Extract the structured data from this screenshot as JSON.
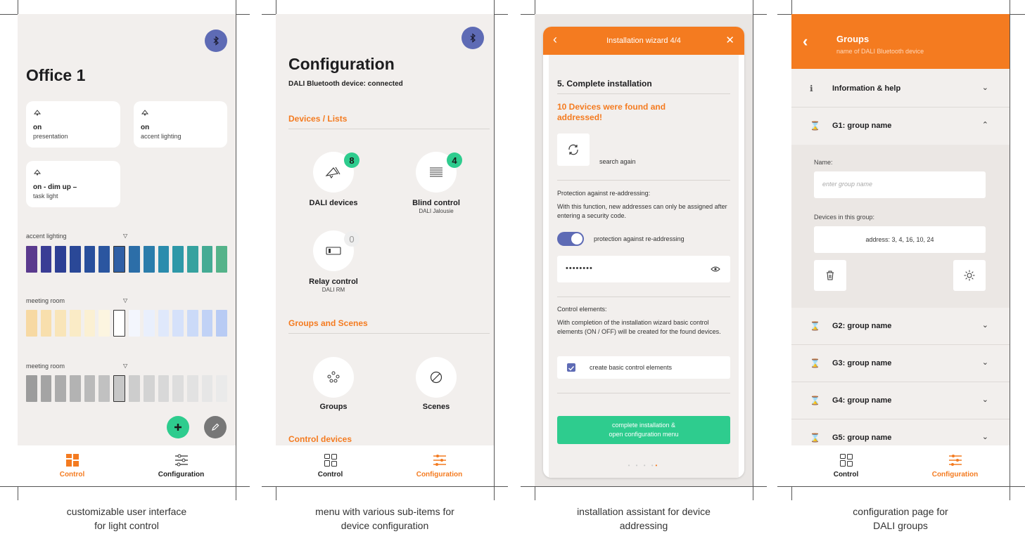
{
  "captions": {
    "p1": [
      "customizable user interface",
      "for light control"
    ],
    "p2": [
      "menu with various sub-items for",
      "device configuration"
    ],
    "p3": [
      "installation assistant for device",
      "addressing"
    ],
    "p4": [
      "configuration page for",
      "DALI groups"
    ]
  },
  "colors": {
    "accent": "#f47b20",
    "green": "#2ecc8e",
    "bluetooth": "#5e6bb5",
    "background": "#f2efed"
  },
  "tabs": {
    "control": "Control",
    "configuration": "Configuration"
  },
  "phone1": {
    "title": "Office 1",
    "tiles": [
      {
        "state": "on",
        "label": "presentation",
        "icon": "lamp-icon"
      },
      {
        "state": "on",
        "label": "accent lighting",
        "icon": "lamp-icon"
      },
      {
        "state": "on - dim up –",
        "label": "task light",
        "icon": "lamp-icon"
      }
    ],
    "strips": [
      {
        "label": "accent lighting",
        "marker": "▽",
        "selected_index": 6,
        "colors": [
          "#5a3a8e",
          "#3a3d95",
          "#2d3f94",
          "#2a4897",
          "#284f9c",
          "#2b56a0",
          "#2f5fa5",
          "#2c6ea8",
          "#2b7dab",
          "#2b8cad",
          "#2e98a8",
          "#36a29f",
          "#44ab94",
          "#55b38a"
        ]
      },
      {
        "label": "meeting room",
        "marker": "▽",
        "selected_index": 6,
        "colors": [
          "#f7d9a3",
          "#f8dfad",
          "#f9e5b9",
          "#faebc6",
          "#fbf0d3",
          "#fcf5e0",
          "#ffffff",
          "#f3f6fd",
          "#e9effc",
          "#dfe8fb",
          "#d5e1fa",
          "#cbdaf8",
          "#c1d2f6",
          "#b8cbf4"
        ]
      },
      {
        "label": "meeting room",
        "marker": "▽",
        "selected_index": 6,
        "colors": [
          "#9c9c9c",
          "#a4a4a4",
          "#acacac",
          "#b3b3b3",
          "#bababa",
          "#c1c1c1",
          "#c7c7c7",
          "#cdcdcd",
          "#d3d3d3",
          "#d8d8d8",
          "#dddddd",
          "#e2e2e2",
          "#e6e6e6",
          "#eaeaea"
        ]
      }
    ]
  },
  "phone2": {
    "title": "Configuration",
    "subtitle": "DALI Bluetooth device: connected",
    "sections": {
      "devices": "Devices / Lists",
      "groups": "Groups and Scenes",
      "control": "Control devices"
    },
    "devices": [
      {
        "label": "DALI devices",
        "sub": "",
        "badge": "8",
        "icon": "dali-lamp-icon"
      },
      {
        "label": "Blind control",
        "sub": "DALI Jalousie",
        "badge": "4",
        "icon": "blind-icon"
      },
      {
        "label": "Relay control",
        "sub": "DALI RM",
        "badge": "0",
        "icon": "relay-icon"
      }
    ],
    "groups": [
      {
        "label": "Groups",
        "icon": "groups-icon"
      },
      {
        "label": "Scenes",
        "icon": "scenes-icon"
      }
    ]
  },
  "phone3": {
    "header": "Installation wizard 4/4",
    "step_title": "5. Complete installation",
    "found_text": "10 Devices were  found and addressed!",
    "search_again": "search again",
    "protection_title": "Protection against re-addressing:",
    "protection_desc": "With this function, new addresses can only be assigned after entering a security code.",
    "protection_toggle": "protection against re-addressing",
    "protection_on": true,
    "password_value": "••••••••",
    "control_title": "Control elements:",
    "control_desc": "With completion of the installation wizard basic control elements (ON / OFF) will be created for the found devices.",
    "checkbox_label": "create basic control elements",
    "checkbox_checked": true,
    "button_line1": "complete installation &",
    "button_line2": "open configuration menu",
    "page_dots": "• • • •"
  },
  "phone4": {
    "title": "Groups",
    "subtitle": "name of DALI Bluetooth device",
    "info_row": "Information & help",
    "g1": "G1: group name",
    "name_label": "Name:",
    "name_placeholder": "enter group name",
    "devices_label": "Devices in this group:",
    "devices_value": "address: 3, 4, 16, 10, 24",
    "groups_collapsed": [
      "G2: group name",
      "G3: group name",
      "G4: group name",
      "G5: group name"
    ]
  }
}
